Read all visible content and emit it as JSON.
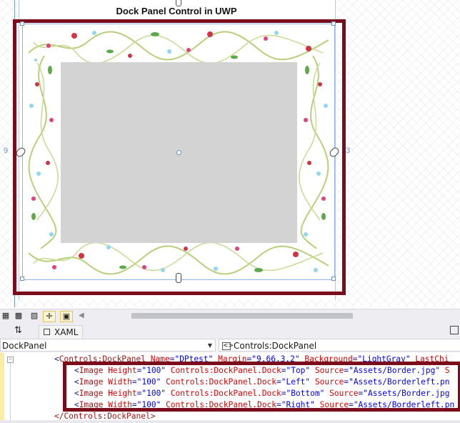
{
  "designer": {
    "page_title": "Dock Panel Control in UWP",
    "margin_left": "9",
    "margin_right": "3"
  },
  "toolbar": {
    "buttons": [
      "grid-icon",
      "snap-icon",
      "checker-icon",
      "crosshair-icon",
      "artboard-icon"
    ]
  },
  "tabs": {
    "swap_label": "⇅",
    "xaml_label": "XAML"
  },
  "selectors": {
    "left_value": "DockPanel",
    "right_value": "Controls:DockPanel"
  },
  "code": {
    "line0": {
      "open": "<",
      "tag": "Controls:DockPanel",
      "a1": "Name",
      "v1": "\"DPtest\"",
      "a2": "Margin",
      "v2": "\"9,66,3,2\"",
      "a3": "Background",
      "v3": "\"LightGray\"",
      "a4": "LastChi"
    },
    "lines": [
      {
        "tag": "Image",
        "a1": "Height",
        "v1": "\"100\"",
        "a2": "Controls:DockPanel.Dock",
        "v2": "\"Top\"",
        "a3": "Source",
        "v3": "\"Assets/Border.jpg\"",
        "tail": " S"
      },
      {
        "tag": "Image",
        "a1": "Width",
        "v1": "\"100\"",
        "a2": "Controls:DockPanel.Dock",
        "v2": "\"Left\"",
        "a3": "Source",
        "v3": "\"Assets/Borderleft.pn",
        "tail": ""
      },
      {
        "tag": "Image",
        "a1": "Height",
        "v1": "\"100\"",
        "a2": "Controls:DockPanel.Dock",
        "v2": "\"Bottom\"",
        "a3": "Source",
        "v3": "\"Assets/Border.jpg",
        "tail": ""
      },
      {
        "tag": "Image",
        "a1": "Width",
        "v1": "\"100\"",
        "a2": "Controls:DockPanel.Dock",
        "v2": "\"Right\"",
        "a3": "Source",
        "v3": "\"Assets/Borderleft.pn",
        "tail": ""
      }
    ],
    "closing": "</Controls:DockPanel>"
  },
  "colors": {
    "highlight": "#7b0c1c",
    "center_fill": "#d3d3d3"
  }
}
